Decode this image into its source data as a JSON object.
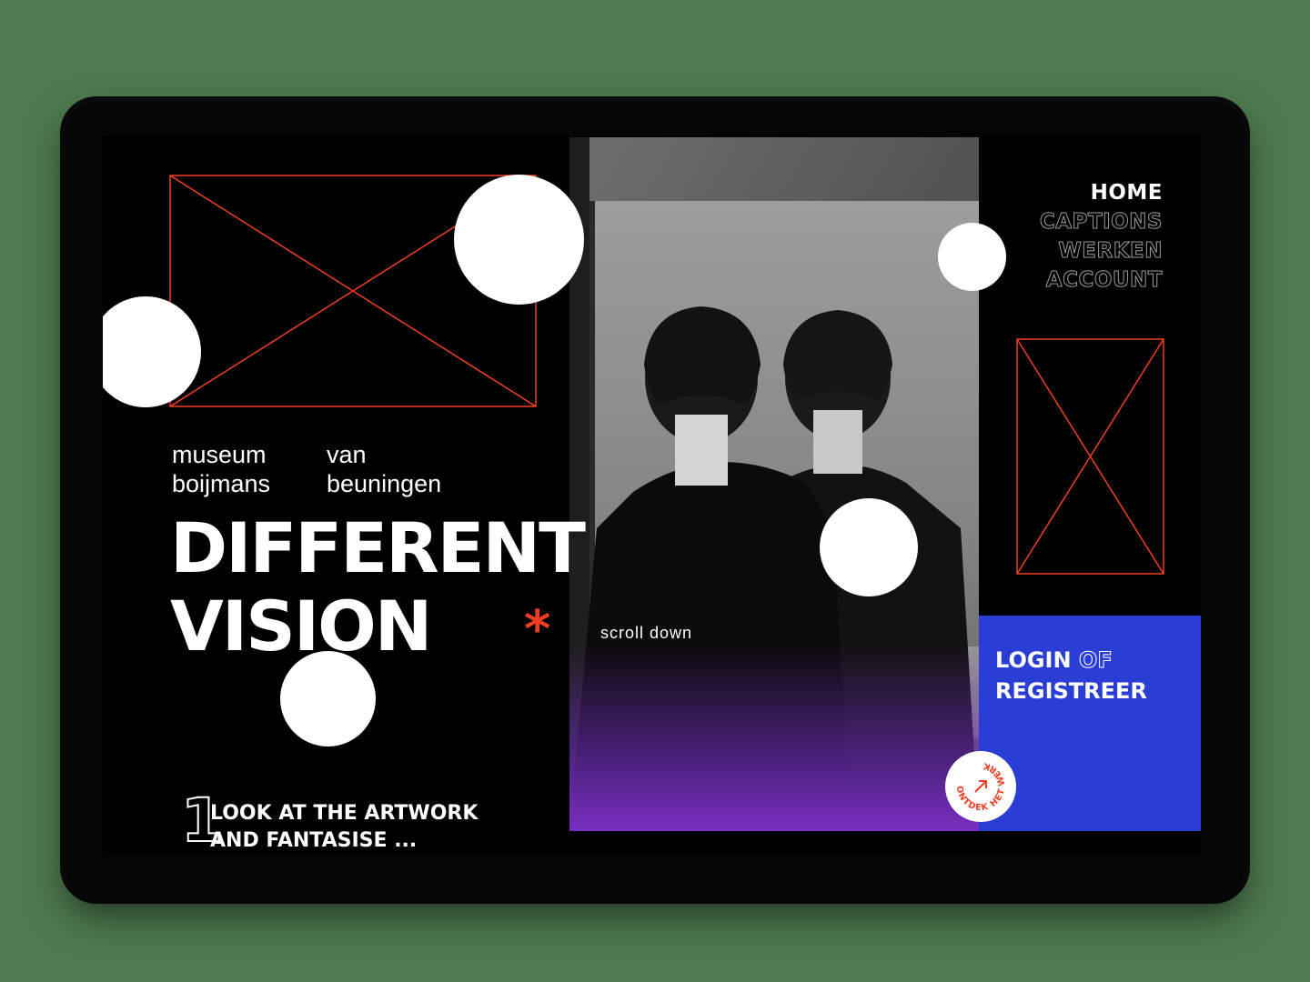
{
  "nav": {
    "items": [
      {
        "label": "HOME",
        "active": true
      },
      {
        "label": "CAPTIONS",
        "active": false
      },
      {
        "label": "WERKEN",
        "active": false
      },
      {
        "label": "ACCOUNT",
        "active": false
      }
    ]
  },
  "brand": {
    "word1": "museum",
    "word2": "van",
    "word3": "boijmans",
    "word4": "beuningen"
  },
  "hero": {
    "line1": "DIFFERENT",
    "line2": "VISION",
    "asterisk": "*",
    "scroll_label": "scroll down"
  },
  "step": {
    "number": "1",
    "line1": "LOOK AT THE ARTWORK",
    "line2": "AND FANTASISE ..."
  },
  "login": {
    "part1": "LOGIN",
    "part2": "OF",
    "part3": "REGISTREER"
  },
  "badge": {
    "text": "ONTDEK HET WERK"
  },
  "colors": {
    "background": "#000000",
    "accent_red": "#ef3e24",
    "login_blue": "#2a3ed6",
    "gradient_purple": "#7a2fc2"
  }
}
